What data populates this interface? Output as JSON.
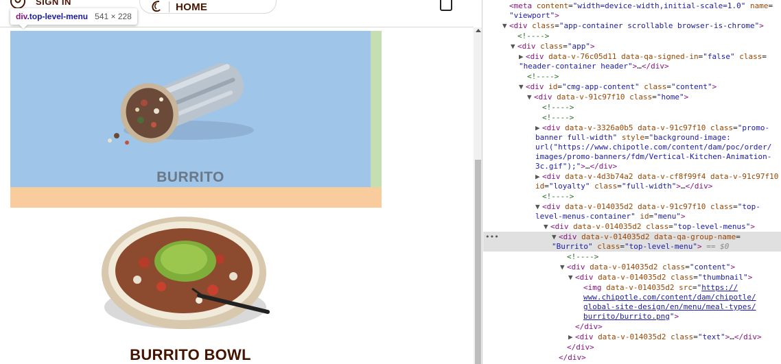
{
  "header": {
    "sign_in": "SIGN IN",
    "home": "HOME",
    "icons": [
      "user-icon",
      "chipotle-logo-icon",
      "bag-icon"
    ]
  },
  "tooltip": {
    "tag": "div",
    "class": ".top-level-menu",
    "dimensions": "541 × 228"
  },
  "menu": {
    "items": [
      {
        "label": "BURRITO"
      },
      {
        "label": "BURRITO BOWL"
      }
    ]
  },
  "highlight_colors": {
    "content": "#9fc5e8",
    "padding": "#c6dfb2",
    "margin": "#f9cc9d"
  },
  "devtools": {
    "lines": [
      "<meta content=\"width=device-width,initial-scale=1.0\" name=",
      "\"viewport\">",
      "<div class=\"app-container scrollable browser-is-chrome\">",
      "<!---->",
      "<div class=\"app\">",
      "<div data-v-76c05d11 data-qa-signed-in=\"false\" class=",
      "\"header-container header\">…</div>",
      "<!---->",
      "<div id=\"cmg-app-content\" class=\"content\">",
      "<div data-v-91c97f10 class=\"home\">",
      "<!---->",
      "<!---->",
      "<div data-v-3326a0b5 data-v-91c97f10 class=\"promo-",
      "banner full-width\" style=\"background-image:",
      "url(\"https://www.chipotle.com/content/dam/poc/order/",
      "images/promo-banners/fdm/Vertical-Kitchen-Animation-",
      "3c.gif\");\">…</div>",
      "<div data-v-4d3b74a2 data-v-cf8f99f4 data-v-91c97f10",
      "id=\"loyalty\" class=\"full-width\">…</div>",
      "<!---->",
      "<div data-v-014035d2 data-v-91c97f10 class=\"top-",
      "level-menus-container\" id=\"menu\">",
      "<div data-v-014035d2 class=\"top-level-menus\">",
      "<div data-v-014035d2 data-qa-group-name=",
      "\"Burrito\" class=\"top-level-menu\"> == $0",
      "<!---->",
      "<div data-v-014035d2 class=\"content\">",
      "<div data-v-014035d2 class=\"thumbnail\">",
      "<img data-v-014035d2 src=\"https://",
      "www.chipotle.com/content/dam/chipotle/",
      "global-site-design/en/menu/meal-types/",
      "burrito/burrito.png\">",
      "</div>",
      "<div data-v-014035d2 class=\"text\">…</div>",
      "</div>",
      "</div>"
    ],
    "selected_marker": "== $0",
    "gutter_dots": "•••"
  }
}
